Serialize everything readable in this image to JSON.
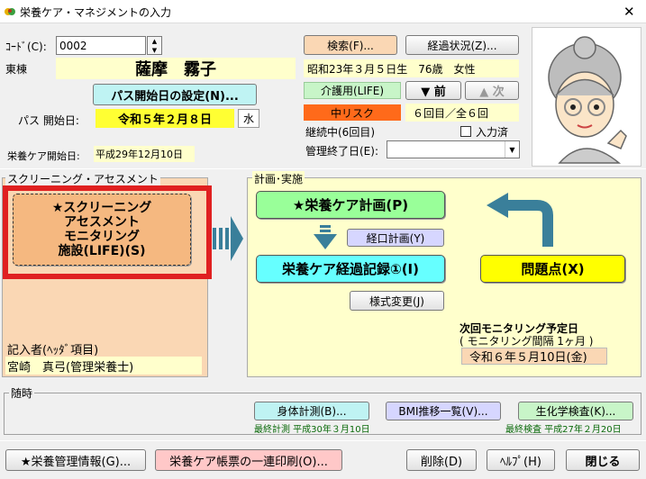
{
  "window": {
    "title": "栄養ケア・マネジメントの入力",
    "close": "✕"
  },
  "colors": {
    "light_yellow": "#ffffcc",
    "pale_orange": "#fad7b4",
    "green_btn": "#99ff99",
    "cyan_btn": "#66ffff",
    "yellow_btn": "#ffff00",
    "red_highlight": "#e02020",
    "risk_orange": "#ff6a1a",
    "life_green": "#c8f5c8",
    "arrow_blue": "#3a7f9a"
  },
  "header": {
    "code_label": "ｺｰﾄﾞ(C):",
    "code_value": "0002",
    "ward": "東棟",
    "patient_name": "薩摩　霧子",
    "path_start_button": "パス開始日の設定(N)...",
    "path_start_label": "パス 開始日:",
    "path_start_date": "令和５年２月８日",
    "path_start_weekday": "水",
    "care_start_label": "栄養ケア開始日:",
    "care_start_value": "平成29年12月10日",
    "search_button": "検索(F)...",
    "history_button": "経過状況(Z)...",
    "birth_info": "昭和23年３月５日生　76歳　女性",
    "care_level": "介護用(LIFE)",
    "prev_button": "▼ 前",
    "next_button": "▲ 次",
    "risk": "中リスク",
    "count_info": "６回目／全６回",
    "continuing": "継続中(6回目)",
    "input_done_label": "入力済",
    "mgmt_end_label": "管理終了日(E):",
    "mgmt_end_value": ""
  },
  "screening": {
    "title": "スクリーニング・アセスメント",
    "big_button_lines": [
      "★スクリーニング",
      "アセスメント",
      "モニタリング",
      "施設(LIFE)(S)"
    ],
    "writer_label": "記入者(ﾍｯﾀﾞ項目)",
    "writer_value": "宮崎　真弓(管理栄養士)"
  },
  "plan": {
    "title": "計画･実施",
    "care_plan_button": "★栄養ケア計画(P)",
    "oral_plan_button": "経口計画(Y)",
    "record_button": "栄養ケア経過記録①(I)",
    "problem_button": "問題点(X)",
    "style_change_button": "様式変更(J)",
    "next_monitoring_label": "次回モニタリング予定日",
    "monitoring_interval": "( モニタリング間隔 1ヶ月 )",
    "next_monitoring_date": "令和６年５月10日(金)"
  },
  "anytime": {
    "title": "随時",
    "body_measure_button": "身体計測(B)...",
    "body_measure_last": "最終計測 平成30年３月10日",
    "bmi_button": "BMI推移一覧(V)...",
    "biochem_button": "生化学検査(K)...",
    "biochem_last": "最終検査 平成27年２月20日"
  },
  "footer": {
    "mgmt_info_button": "★栄養管理情報(G)...",
    "print_button": "栄養ケア帳票の一連印刷(O)...",
    "delete_button": "削除(D)",
    "help_button": "ﾍﾙﾌﾟ(H)",
    "close_button": "閉じる"
  }
}
